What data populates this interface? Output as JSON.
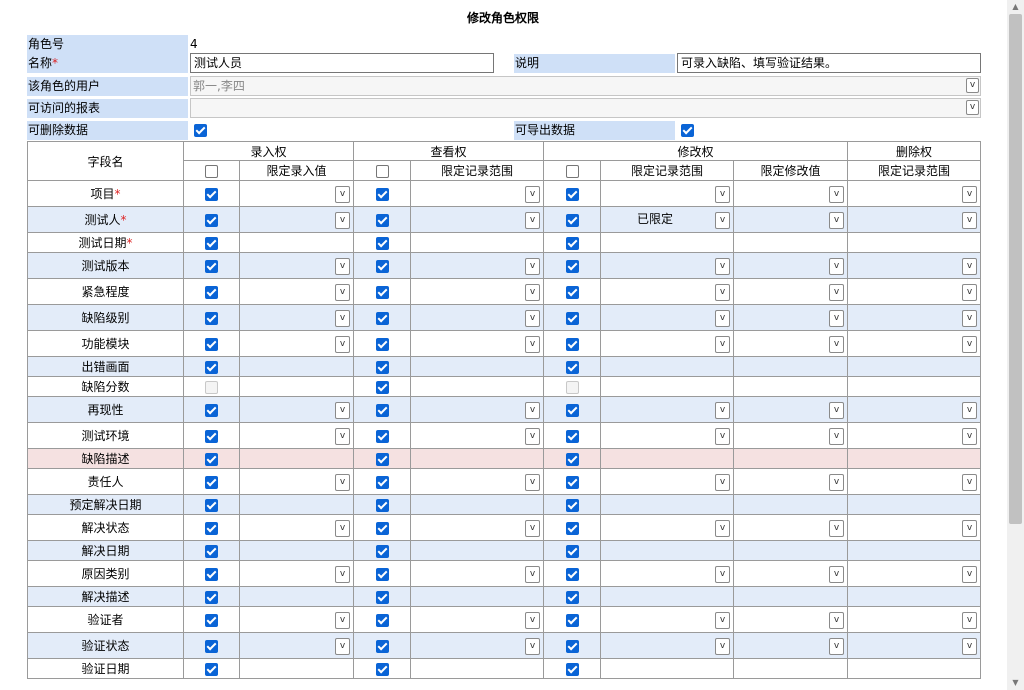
{
  "page": {
    "title": "修改角色权限"
  },
  "form": {
    "role_no": {
      "label": "角色号",
      "value": "4"
    },
    "name": {
      "label": "名称",
      "required_mark": "*",
      "value": "测试人员"
    },
    "desc": {
      "label": "说明",
      "value": "可录入缺陷、填写验证结果。"
    },
    "users": {
      "label": "该角色的用户",
      "value": "郭一,李四"
    },
    "reports": {
      "label": "可访问的报表",
      "value": ""
    },
    "can_delete": {
      "label": "可删除数据",
      "checked": true
    },
    "can_export": {
      "label": "可导出数据",
      "checked": true
    }
  },
  "table": {
    "headers": {
      "field": "字段名",
      "entry": "录入权",
      "view": "查看权",
      "modify": "修改权",
      "delete": "删除权",
      "entry_limit_value": "限定录入值",
      "view_limit_range": "限定记录范围",
      "modify_limit_range": "限定记录范围",
      "modify_limit_value": "限定修改值",
      "delete_limit_range": "限定记录范围"
    },
    "select_arrow": "v",
    "rows": [
      {
        "name": "项目",
        "req": "*",
        "e": 1,
        "es": 1,
        "v": 1,
        "vs": 1,
        "m": 1,
        "mr": 1,
        "mv": 1,
        "d": 1,
        "mrText": ""
      },
      {
        "name": "测试人",
        "req": "*",
        "e": 1,
        "es": 1,
        "v": 1,
        "vs": 1,
        "m": 1,
        "mr": 1,
        "mv": 1,
        "d": 1,
        "mrText": "已限定"
      },
      {
        "name": "测试日期",
        "req": "*",
        "e": 1,
        "es": 0,
        "v": 1,
        "vs": 0,
        "m": 1,
        "mr": 0,
        "mv": 0,
        "d": 0,
        "mrText": ""
      },
      {
        "name": "测试版本",
        "req": "",
        "e": 1,
        "es": 1,
        "v": 1,
        "vs": 1,
        "m": 1,
        "mr": 1,
        "mv": 1,
        "d": 1,
        "mrText": ""
      },
      {
        "name": "紧急程度",
        "req": "",
        "e": 1,
        "es": 1,
        "v": 1,
        "vs": 1,
        "m": 1,
        "mr": 1,
        "mv": 1,
        "d": 1,
        "mrText": ""
      },
      {
        "name": "缺陷级别",
        "req": "",
        "e": 1,
        "es": 1,
        "v": 1,
        "vs": 1,
        "m": 1,
        "mr": 1,
        "mv": 1,
        "d": 1,
        "mrText": ""
      },
      {
        "name": "功能模块",
        "req": "",
        "e": 1,
        "es": 1,
        "v": 1,
        "vs": 1,
        "m": 1,
        "mr": 1,
        "mv": 1,
        "d": 1,
        "mrText": ""
      },
      {
        "name": "出错画面",
        "req": "",
        "e": 1,
        "es": 0,
        "v": 1,
        "vs": 0,
        "m": 1,
        "mr": 0,
        "mv": 0,
        "d": 0,
        "mrText": ""
      },
      {
        "name": "缺陷分数",
        "req": "",
        "e": 2,
        "es": 0,
        "v": 1,
        "vs": 0,
        "m": 2,
        "mr": 0,
        "mv": 0,
        "d": 0,
        "mrText": ""
      },
      {
        "name": "再现性",
        "req": "",
        "e": 1,
        "es": 1,
        "v": 1,
        "vs": 1,
        "m": 1,
        "mr": 1,
        "mv": 1,
        "d": 1,
        "mrText": ""
      },
      {
        "name": "测试环境",
        "req": "",
        "e": 1,
        "es": 1,
        "v": 1,
        "vs": 1,
        "m": 1,
        "mr": 1,
        "mv": 1,
        "d": 1,
        "mrText": ""
      },
      {
        "name": "缺陷描述",
        "req": "",
        "e": 1,
        "es": 0,
        "v": 1,
        "vs": 0,
        "m": 1,
        "mr": 0,
        "mv": 0,
        "d": 0,
        "mrText": "",
        "pink": true
      },
      {
        "name": "责任人",
        "req": "",
        "e": 1,
        "es": 1,
        "v": 1,
        "vs": 1,
        "m": 1,
        "mr": 1,
        "mv": 1,
        "d": 1,
        "mrText": ""
      },
      {
        "name": "预定解决日期",
        "req": "",
        "e": 1,
        "es": 0,
        "v": 1,
        "vs": 0,
        "m": 1,
        "mr": 0,
        "mv": 0,
        "d": 0,
        "mrText": ""
      },
      {
        "name": "解决状态",
        "req": "",
        "e": 1,
        "es": 1,
        "v": 1,
        "vs": 1,
        "m": 1,
        "mr": 1,
        "mv": 1,
        "d": 1,
        "mrText": ""
      },
      {
        "name": "解决日期",
        "req": "",
        "e": 1,
        "es": 0,
        "v": 1,
        "vs": 0,
        "m": 1,
        "mr": 0,
        "mv": 0,
        "d": 0,
        "mrText": ""
      },
      {
        "name": "原因类别",
        "req": "",
        "e": 1,
        "es": 1,
        "v": 1,
        "vs": 1,
        "m": 1,
        "mr": 1,
        "mv": 1,
        "d": 1,
        "mrText": ""
      },
      {
        "name": "解决描述",
        "req": "",
        "e": 1,
        "es": 0,
        "v": 1,
        "vs": 0,
        "m": 1,
        "mr": 0,
        "mv": 0,
        "d": 0,
        "mrText": ""
      },
      {
        "name": "验证者",
        "req": "",
        "e": 1,
        "es": 1,
        "v": 1,
        "vs": 1,
        "m": 1,
        "mr": 1,
        "mv": 1,
        "d": 1,
        "mrText": ""
      },
      {
        "name": "验证状态",
        "req": "",
        "e": 1,
        "es": 1,
        "v": 1,
        "vs": 1,
        "m": 1,
        "mr": 1,
        "mv": 1,
        "d": 1,
        "mrText": ""
      },
      {
        "name": "验证日期",
        "req": "",
        "e": 1,
        "es": 0,
        "v": 1,
        "vs": 0,
        "m": 1,
        "mr": 0,
        "mv": 0,
        "d": 0,
        "mrText": ""
      }
    ]
  }
}
